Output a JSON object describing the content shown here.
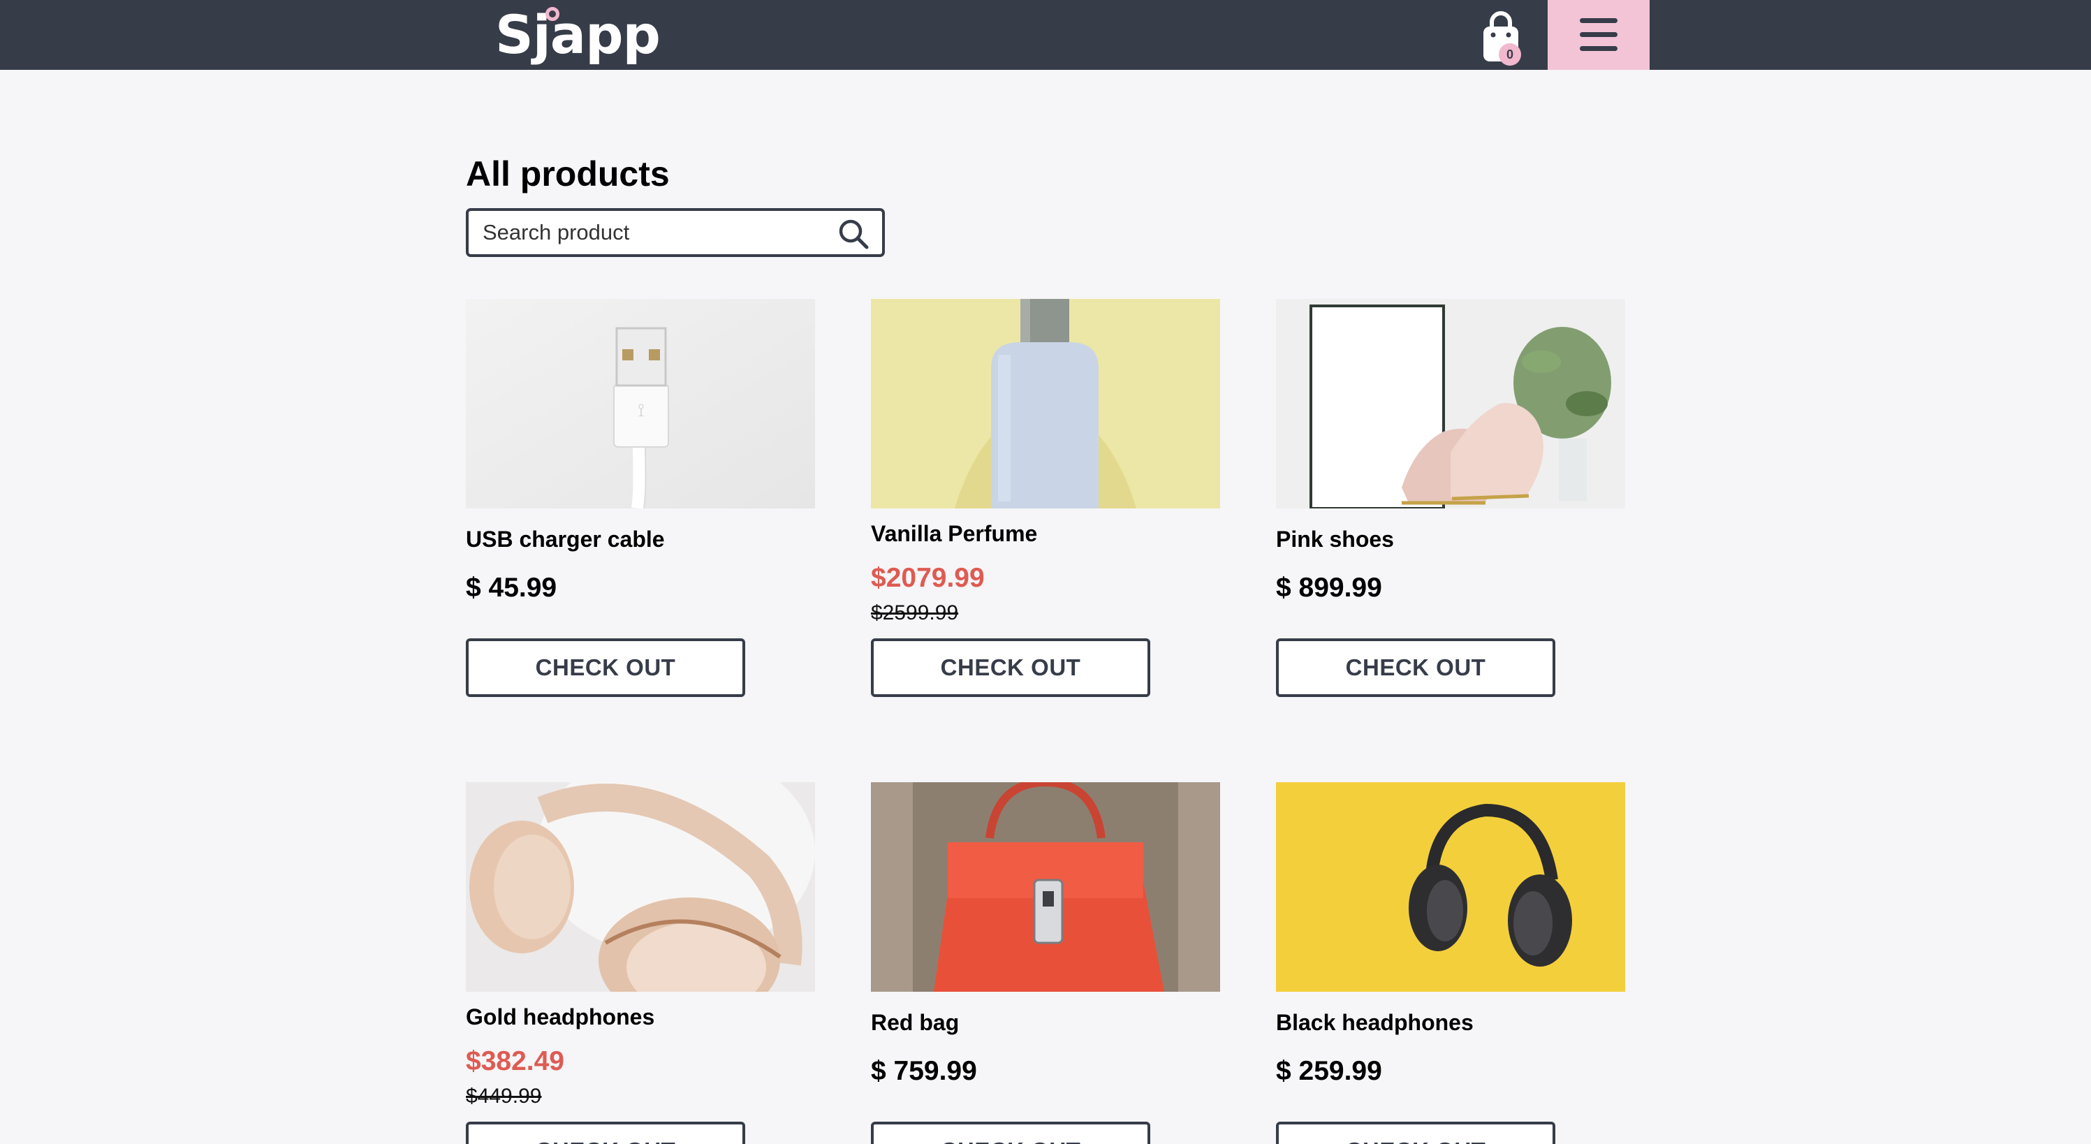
{
  "header": {
    "logo_text": "Sjapp",
    "cart_count": "0",
    "colors": {
      "bar": "#373c49",
      "accent": "#f2c4d6"
    }
  },
  "main": {
    "title": "All products",
    "search": {
      "placeholder": "Search product",
      "value": ""
    }
  },
  "products": [
    {
      "name": "USB charger cable",
      "price": "$ 45.99",
      "button": "CHECK OUT"
    },
    {
      "name": "Vanilla Perfume",
      "price": "$2079.99",
      "old_price": "$2599.99",
      "button": "CHECK OUT"
    },
    {
      "name": "Pink shoes",
      "price": "$ 899.99",
      "button": "CHECK OUT"
    },
    {
      "name": "Gold headphones",
      "price": "$382.49",
      "old_price": "$449.99",
      "button": "CHECK OUT"
    },
    {
      "name": "Red bag",
      "price": "$ 759.99",
      "button": "CHECK OUT"
    },
    {
      "name": "Black headphones",
      "price": "$ 259.99",
      "button": "CHECK OUT"
    }
  ],
  "icons": {
    "cart": "shopping-bag-icon",
    "menu": "hamburger-menu-icon",
    "search": "search-icon"
  }
}
